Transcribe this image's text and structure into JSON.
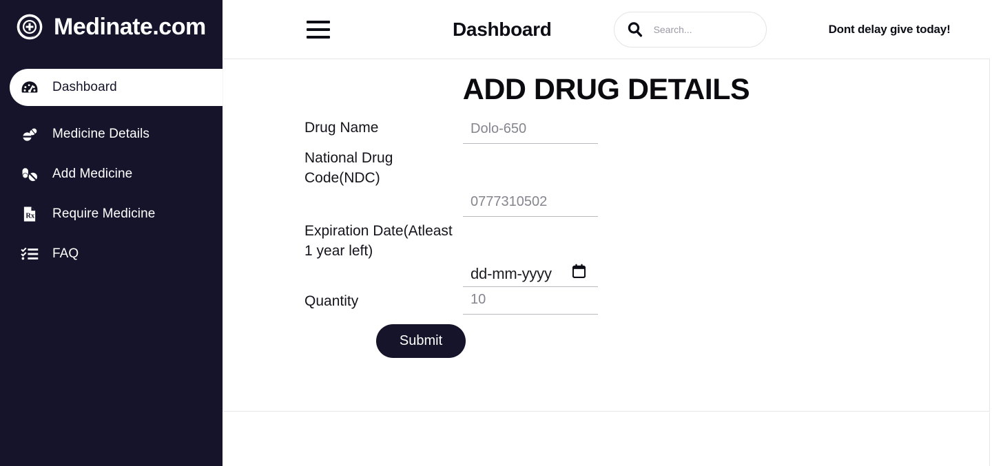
{
  "brand": {
    "name": "Medinate.com",
    "logo_icon": "medical-cross-circle-icon"
  },
  "sidebar": {
    "items": [
      {
        "label": "Dashboard",
        "icon": "speedometer-icon",
        "active": true
      },
      {
        "label": "Medicine Details",
        "icon": "pills-icon",
        "active": false
      },
      {
        "label": "Add Medicine",
        "icon": "capsule-pill-icon",
        "active": false
      },
      {
        "label": "Require Medicine",
        "icon": "rx-document-icon",
        "active": false
      },
      {
        "label": "FAQ",
        "icon": "checklist-icon",
        "active": false
      }
    ]
  },
  "header": {
    "menu_icon": "hamburger-menu-icon",
    "title": "Dashboard",
    "search": {
      "icon": "search-icon",
      "placeholder": "Search...",
      "value": ""
    },
    "tagline": "Dont delay give today!"
  },
  "main": {
    "title": "ADD DRUG DETAILS",
    "fields": [
      {
        "label": "Drug Name",
        "placeholder": "Dolo-650",
        "value": "",
        "type": "text"
      },
      {
        "label": "National Drug Code(NDC)",
        "placeholder": "0777310502",
        "value": "",
        "type": "text"
      },
      {
        "label": "Expiration Date(Atleast 1 year left)",
        "placeholder": "dd-mm-yyyy",
        "value": "",
        "type": "date",
        "icon": "calendar-icon"
      },
      {
        "label": "Quantity",
        "placeholder": "10",
        "value": "",
        "type": "number"
      }
    ],
    "submit_label": "Submit"
  },
  "colors": {
    "sidebar_bg": "#15142a",
    "accent_dark": "#15142a",
    "text_primary": "#0d0d16",
    "placeholder": "#85858f",
    "border": "#e6e6e9"
  }
}
